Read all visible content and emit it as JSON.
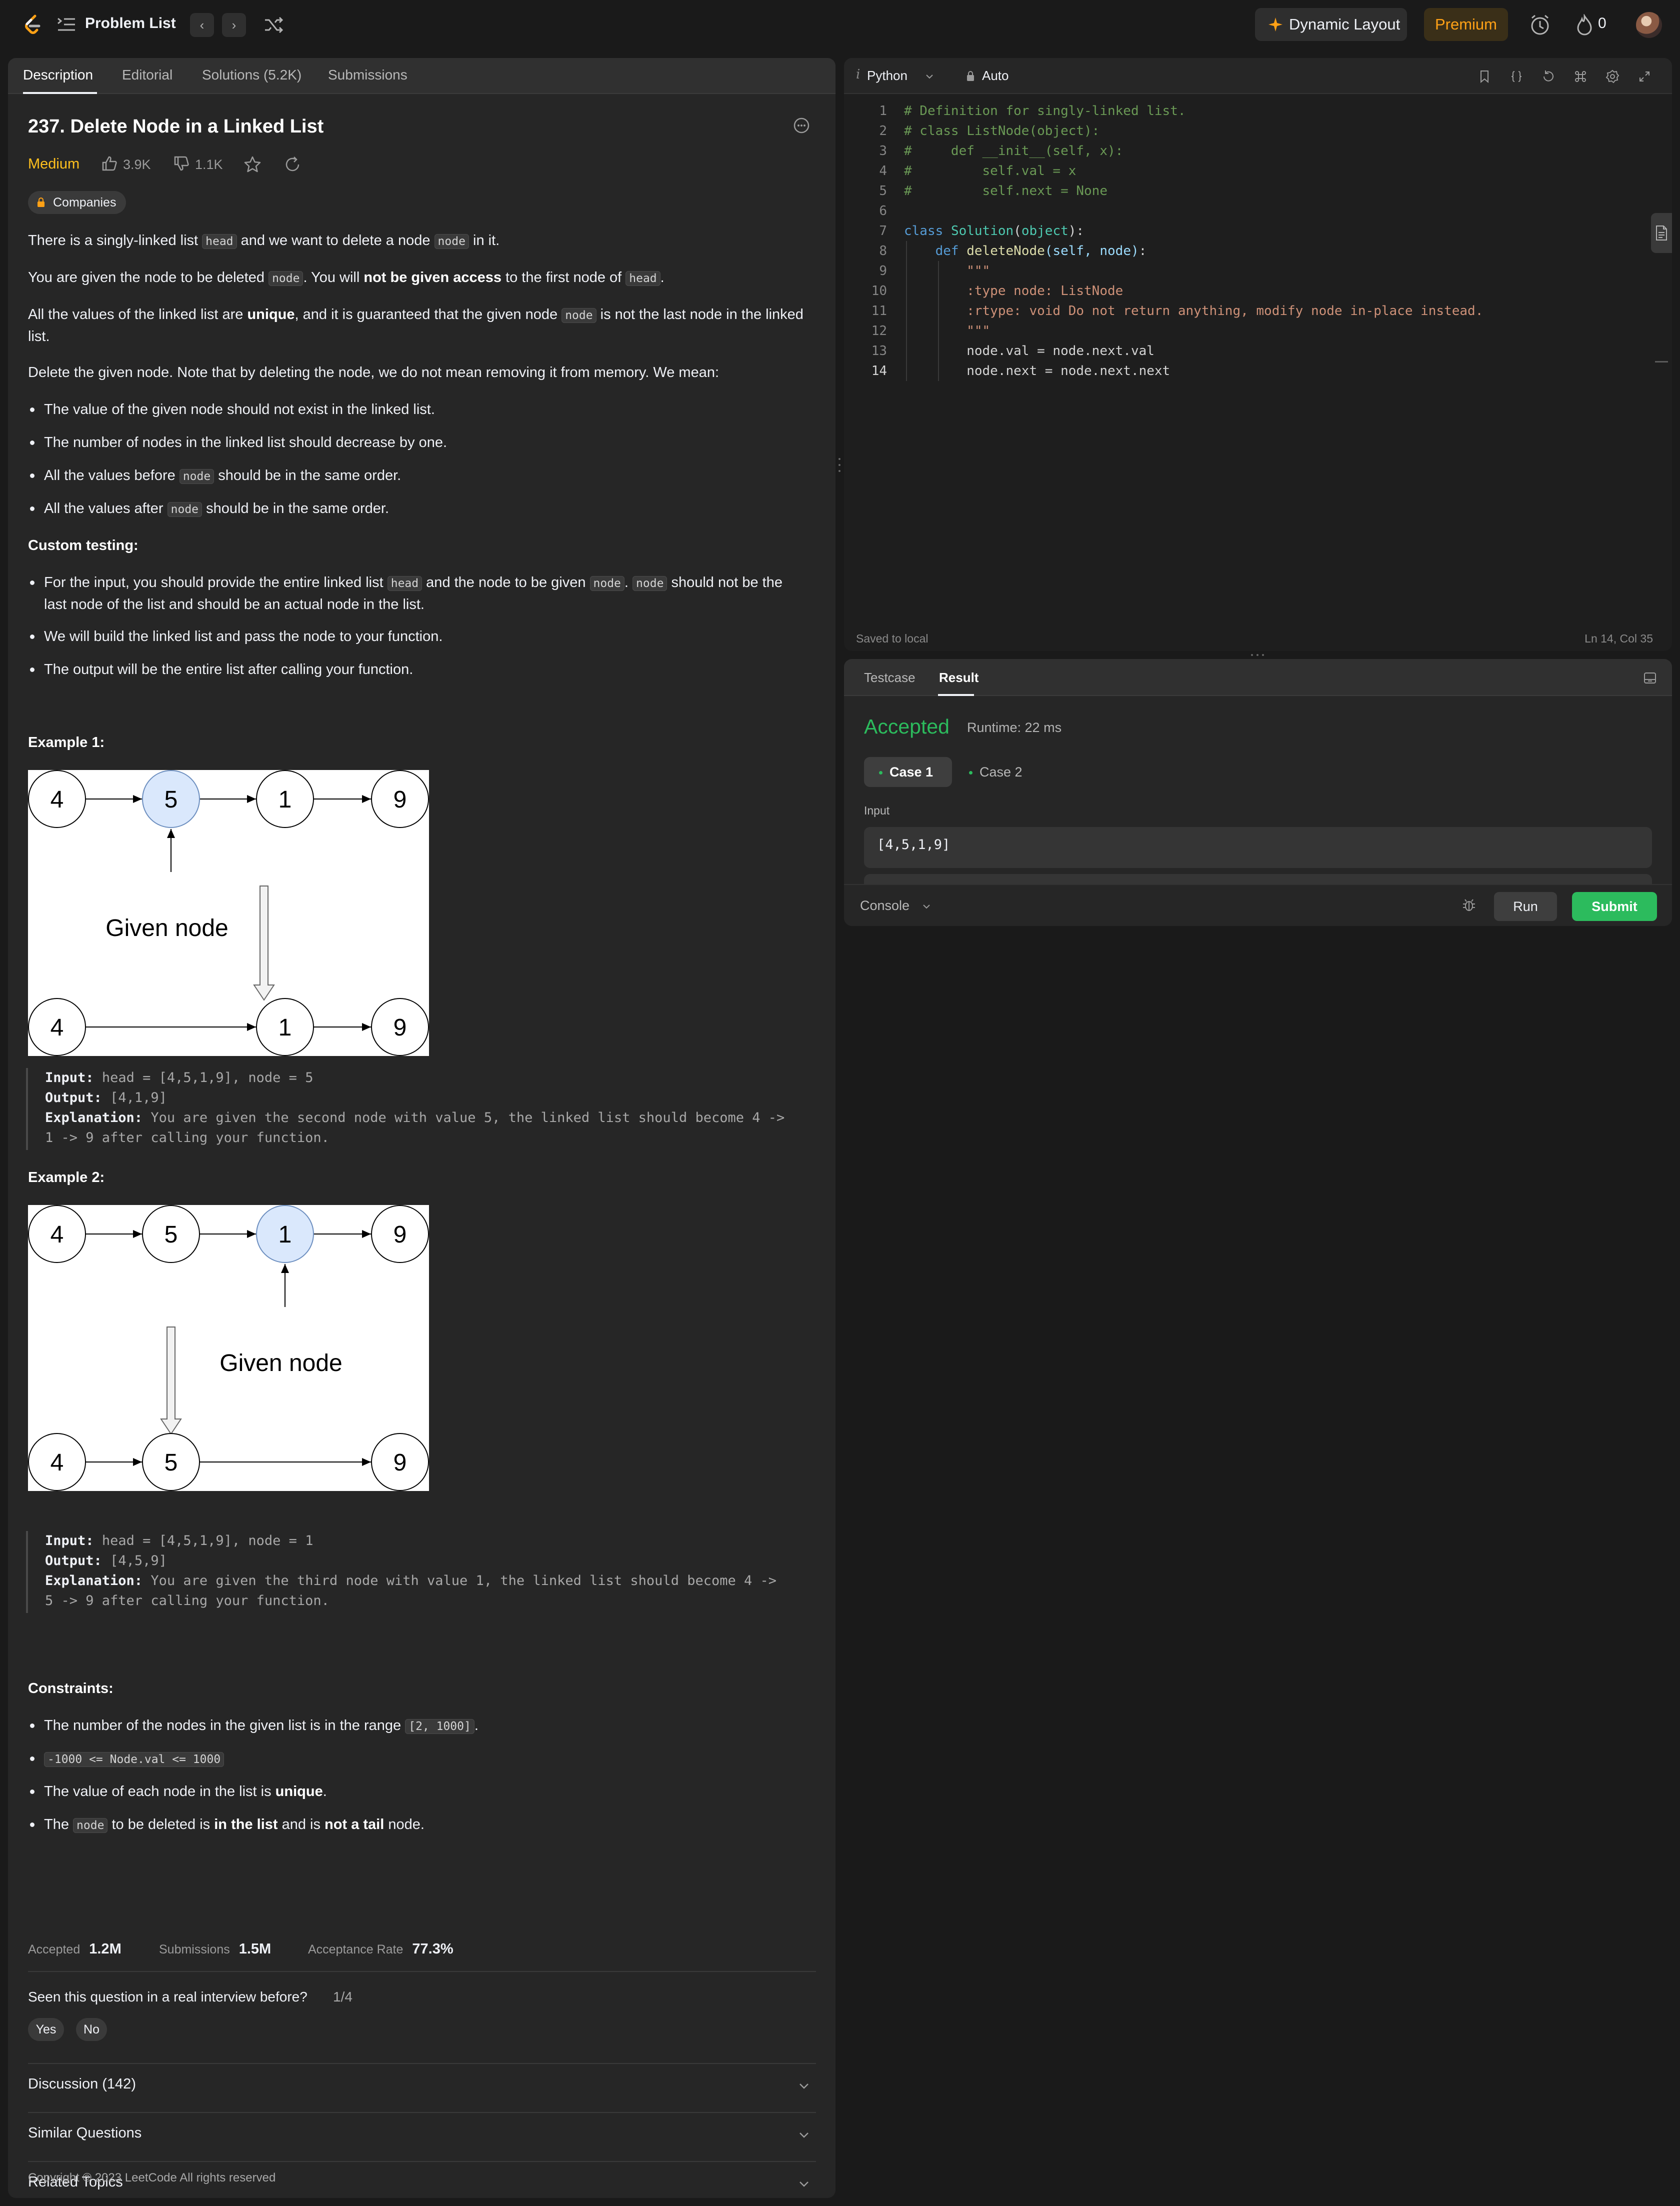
{
  "topbar": {
    "title": "Problem List",
    "prev": "‹",
    "next": "›",
    "dynamic_layout": "Dynamic Layout",
    "premium": "Premium",
    "streak": "0"
  },
  "left_tabs": [
    "Description",
    "Editorial",
    "Solutions (5.2K)",
    "Submissions"
  ],
  "problem": {
    "title": "237. Delete Node in a Linked List",
    "difficulty": "Medium",
    "likes": "3.9K",
    "dislikes": "1.1K",
    "companies": "Companies",
    "p1": [
      "There is a singly-linked list ",
      "head",
      " and we want to delete a node ",
      "node",
      " in it."
    ],
    "p2": [
      "You are given the node to be deleted ",
      "node",
      ". You will ",
      "not be given access",
      " to the first node of ",
      "head",
      "."
    ],
    "p3": [
      "All the values of the linked list are ",
      "unique",
      ", and it is guaranteed that the given node ",
      "node",
      " is not the last node in the linked list."
    ],
    "p4": "Delete the given node. Note that by deleting the node, we do not mean removing it from memory. We mean:",
    "b1": "The value of the given node should not exist in the linked list.",
    "b2": "The number of nodes in the linked list should decrease by one.",
    "b3": [
      "All the values before ",
      "node",
      " should be in the same order."
    ],
    "b4": [
      "All the values after ",
      "node",
      " should be in the same order."
    ],
    "custom_heading": "Custom testing:",
    "c1": [
      "For the input, you should provide the entire linked list ",
      "head",
      " and the node to be given ",
      "node",
      ". ",
      "node",
      " should not be the last node of the list and should be an actual node in the list."
    ],
    "c2": "We will build the linked list and pass the node to your function.",
    "c3": "The output will be the entire list after calling your function.",
    "example1_heading": "Example 1:",
    "example1_diagram": {
      "top": [
        "4",
        "5",
        "1",
        "9"
      ],
      "bottom": [
        "4",
        "1",
        "9"
      ],
      "label": "Given node"
    },
    "example1": {
      "input_label": "Input:",
      "input": "head = [4,5,1,9], node = 5",
      "output_label": "Output:",
      "output": "[4,1,9]",
      "expl_label": "Explanation:",
      "expl_1": "You are given the second node with value 5, the linked list should become 4 ->",
      "expl_2": "1 -> 9 after calling your function."
    },
    "example2_heading": "Example 2:",
    "example2_diagram": {
      "top": [
        "4",
        "5",
        "1",
        "9"
      ],
      "bottom": [
        "4",
        "5",
        "9"
      ],
      "label": "Given node"
    },
    "example2": {
      "input_label": "Input:",
      "input": "head = [4,5,1,9], node = 1",
      "output_label": "Output:",
      "output": "[4,5,9]",
      "expl_label": "Explanation:",
      "expl_1": "You are given the third node with value 1, the linked list should become 4 ->",
      "expl_2": "5 -> 9 after calling your function."
    },
    "constraints_heading": "Constraints:",
    "k1": [
      "The number of the nodes in the given list is in the range ",
      "[2, 1000]",
      "."
    ],
    "k2": "-1000 <= Node.val <= 1000",
    "k3": [
      "The value of each node in the list is ",
      "unique",
      "."
    ],
    "k4": [
      "The ",
      "node",
      " to be deleted is ",
      "in the list",
      " and is ",
      "not a tail",
      " node."
    ]
  },
  "stats": {
    "accepted_label": "Accepted",
    "accepted": "1.2M",
    "submissions_label": "Submissions",
    "submissions": "1.5M",
    "rate_label": "Acceptance Rate",
    "rate": "77.3%"
  },
  "interview": {
    "question": "Seen this question in a real interview before?",
    "count": "1/4",
    "yes": "Yes",
    "no": "No"
  },
  "accordions": [
    "Discussion (142)",
    "Similar Questions",
    "Related Topics"
  ],
  "copyright": "Copyright © 2023 LeetCode All rights reserved",
  "editor": {
    "lang_icon": "i",
    "language": "Python",
    "mode": "Auto",
    "lines": [
      "# Definition for singly-linked list.",
      "# class ListNode(object):",
      "#     def __init__(self, x):",
      "#         self.val = x",
      "#         self.next = None",
      "",
      "class Solution(object):",
      "    def deleteNode(self, node):",
      "        \"\"\"",
      "        :type node: ListNode",
      "        :rtype: void Do not return anything, modify node in-place instead.",
      "        \"\"\"",
      "        node.val = node.next.val",
      "        node.next = node.next.next"
    ],
    "saved": "Saved to local",
    "position": "Ln 14, Col 35"
  },
  "result": {
    "tabs": [
      "Testcase",
      "Result"
    ],
    "status": "Accepted",
    "runtime": "Runtime: 22 ms",
    "cases": [
      "Case 1",
      "Case 2"
    ],
    "input_label": "Input",
    "input_value": "[4,5,1,9]",
    "console": "Console",
    "run": "Run",
    "submit": "Submit"
  },
  "colors": {
    "accent_green": "#2cbb5d",
    "medium": "#ffc01e",
    "premium": "#ffa116",
    "highlight_node": "#dae8fc"
  }
}
